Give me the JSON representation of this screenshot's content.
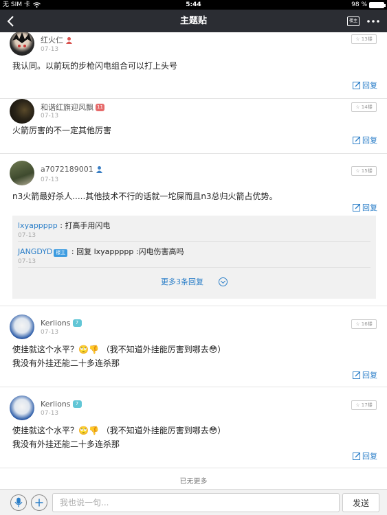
{
  "status_bar": {
    "carrier": "无 SIM 卡",
    "time": "5:44",
    "battery": "98 %",
    "battery_level": 0.98
  },
  "nav": {
    "title": "主题贴",
    "op_label": "楼主"
  },
  "posts": [
    {
      "username": "红火仁",
      "date": "07-13",
      "floor": "13楼",
      "text": "我认同。以前玩的步枪闪电组合可以打上头号",
      "reply_label": "回复"
    },
    {
      "username": "和谐红旗迎风飘",
      "level": "11",
      "date": "07-13",
      "floor": "14楼",
      "text": "火箭厉害的不一定其他厉害",
      "reply_label": "回复"
    },
    {
      "username": "a7072189001",
      "date": "07-13",
      "floor": "15楼",
      "text": "n3火箭最好杀人.....其他技术不行的话就一坨屎而且n3总归火箭占优势。",
      "reply_label": "回复",
      "sub_replies": [
        {
          "user": "lxyappppp",
          "separator": " : ",
          "text": "打高手用闪电",
          "date": "07-13"
        },
        {
          "user": "JANGDYD",
          "op_badge": "楼主",
          "separator": " : ",
          "text": "回复 lxyappppp :闪电伤害高吗",
          "date": "07-13"
        }
      ],
      "more_replies": "更多3条回复"
    },
    {
      "username": "Kerlions",
      "level": "7",
      "date": "07-13",
      "floor": "16楼",
      "text_line1": "使挂就这个水平？🙄👎 （我不知道外挂能厉害到哪去😳）",
      "text_line2": "我没有外挂还能二十多连杀那",
      "reply_label": "回复"
    },
    {
      "username": "Kerlions",
      "level": "7",
      "date": "07-13",
      "floor": "17楼",
      "text_line1": "使挂就这个水平？🙄👎 （我不知道外挂能厉害到哪去😳）",
      "text_line2": "我没有外挂还能二十多连杀那",
      "reply_label": "回复"
    }
  ],
  "no_more": "已无更多",
  "composer": {
    "placeholder": "我也说一句...",
    "send_label": "发送"
  },
  "colors": {
    "link": "#2a7ec8",
    "navbar": "#2b2d33",
    "op_badge": "#3b9be0",
    "level_red": "#e66a6a",
    "level_teal": "#62c6d6"
  },
  "icons": {
    "back": "chevron-left-icon",
    "more": "more-dots-icon",
    "reply": "edit-reply-icon",
    "mic": "microphone-icon",
    "plus": "plus-icon"
  }
}
